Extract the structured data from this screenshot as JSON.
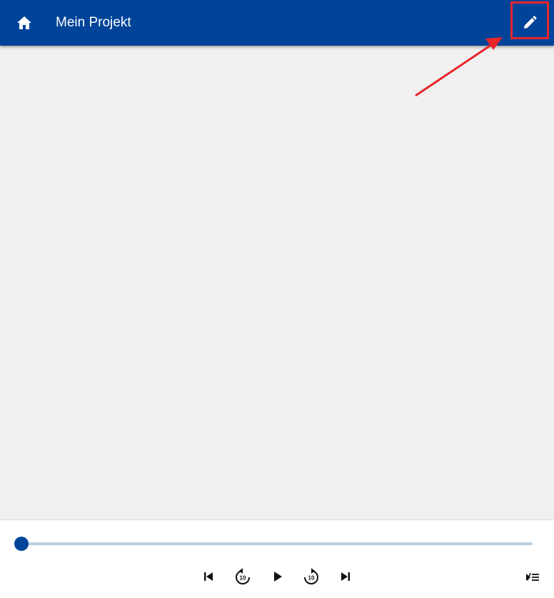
{
  "appbar": {
    "title": "Mein Projekt",
    "home_icon": "home-icon",
    "edit_icon": "pencil-icon",
    "background_color": "#00449a"
  },
  "annotation": {
    "highlight_color": "#e8262a",
    "target": "edit-button"
  },
  "player": {
    "progress": 0,
    "accent_color": "#00449a",
    "track_color": "#b9cfe0",
    "controls": [
      {
        "name": "skip-previous-button",
        "icon": "skip-previous-icon"
      },
      {
        "name": "replay-10-button",
        "icon": "replay-10-icon",
        "label": "10"
      },
      {
        "name": "play-button",
        "icon": "play-icon"
      },
      {
        "name": "forward-10-button",
        "icon": "forward-10-icon",
        "label": "10"
      },
      {
        "name": "skip-next-button",
        "icon": "skip-next-icon"
      }
    ],
    "speed_icon": "speed-list-icon"
  }
}
